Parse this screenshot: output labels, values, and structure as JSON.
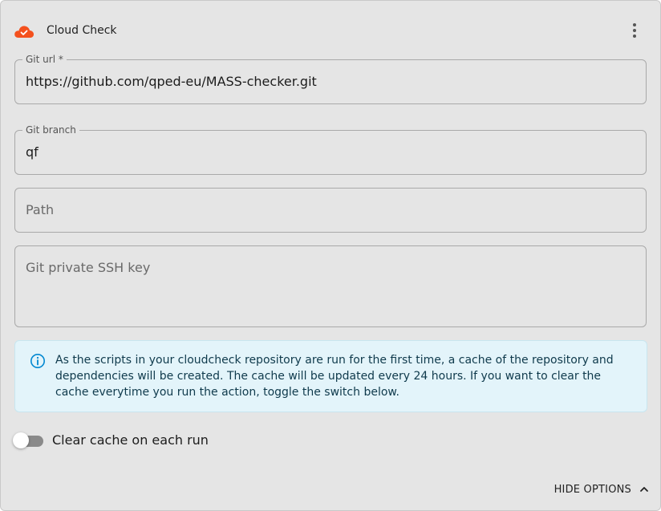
{
  "header": {
    "title": "Cloud Check",
    "icon": "cloud-check-icon",
    "icon_color": "#f4511e"
  },
  "fields": {
    "git_url": {
      "label": "Git url *",
      "value": "https://github.com/qped-eu/MASS-checker.git"
    },
    "git_branch": {
      "label": "Git branch",
      "value": "qf"
    },
    "path": {
      "placeholder": "Path",
      "value": ""
    },
    "ssh_key": {
      "placeholder": "Git private SSH key",
      "value": ""
    }
  },
  "info": {
    "icon": "info-icon",
    "color": "#0288d1",
    "text": "As the scripts in your cloudcheck repository are run for the first time, a cache of the repository and dependencies will be created. The cache will be updated every 24 hours. If you want to clear the cache everytime you run the action, toggle the switch below."
  },
  "toggle": {
    "label": "Clear cache on each run",
    "checked": false
  },
  "footer": {
    "hide_options_label": "HIDE OPTIONS",
    "icon": "chevron-up-icon"
  }
}
